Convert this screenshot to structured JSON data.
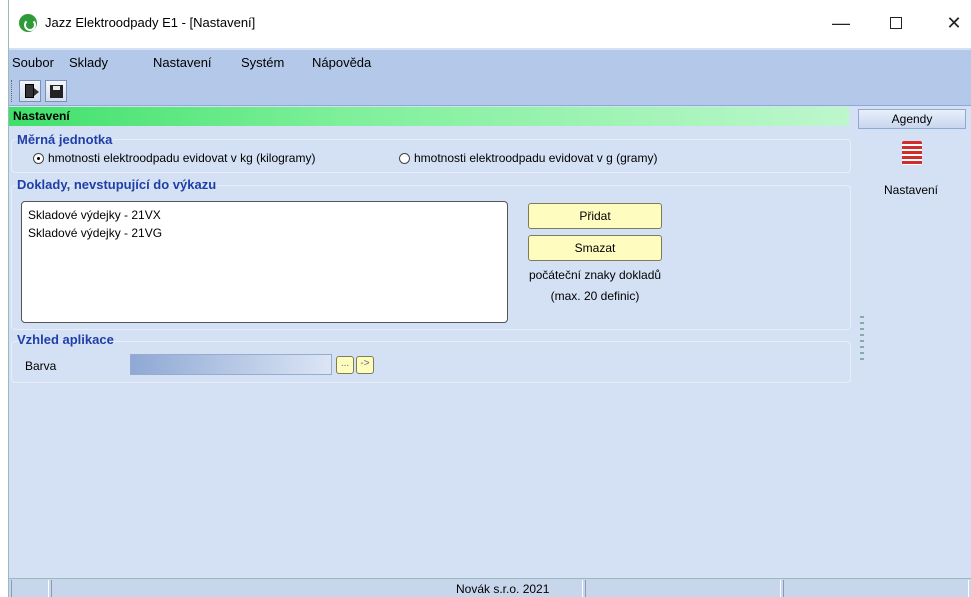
{
  "window": {
    "title": "Jazz Elektroodpady E1 - [Nastavení]"
  },
  "menu": [
    "Soubor",
    "Sklady",
    "Nastavení",
    "Systém",
    "Nápověda"
  ],
  "toolbar": {
    "exit_icon": "exit-door-icon",
    "save_icon": "floppy-disk-icon"
  },
  "header": {
    "title": "Nastavení"
  },
  "sidebar": {
    "agendy_label": "Agendy",
    "item_label": "Nastavení",
    "item_icon": "settings-list-icon"
  },
  "unit_group": {
    "title": "Měrná jednotka",
    "option_kg": "hmotnosti elektroodpadu evidovat v kg (kilogramy)",
    "option_g": "hmotnosti elektroodpadu evidovat v g (gramy)",
    "selected": "kg"
  },
  "documents_group": {
    "title": "Doklady, nevstupující do výkazu",
    "items": [
      "Skladové výdejky - 21VX",
      "Skladové výdejky - 21VG"
    ],
    "add_label": "Přidat",
    "delete_label": "Smazat",
    "hint_line1": "počáteční znaky dokladů",
    "hint_line2": "(max. 20 definic)"
  },
  "appearance_group": {
    "title": "Vzhled aplikace",
    "color_label": "Barva",
    "browse_label": "...",
    "apply_label": "->"
  },
  "status": {
    "company": "Novák s.r.o. 2021"
  }
}
